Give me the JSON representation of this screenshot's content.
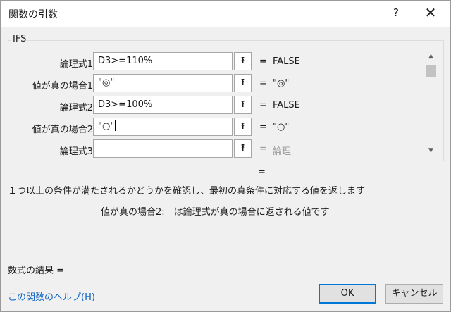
{
  "window": {
    "title": "関数の引数",
    "help_glyph": "?",
    "close_glyph": "✕"
  },
  "group_label": "IFS",
  "args": [
    {
      "label": "論理式1",
      "value": "D3>=110%",
      "eq": "=",
      "result": "FALSE"
    },
    {
      "label": "値が真の場合1",
      "value": "\"◎\"",
      "eq": "=",
      "result": "\"◎\""
    },
    {
      "label": "論理式2",
      "value": "D3>=100%",
      "eq": "=",
      "result": "FALSE"
    },
    {
      "label": "値が真の場合2",
      "value": "\"○\"",
      "eq": "=",
      "result": "\"○\""
    },
    {
      "label": "論理式3",
      "value": "",
      "eq": "=",
      "result": "論理"
    }
  ],
  "ref_glyph": "⭱",
  "scroll": {
    "up": "▲",
    "down": "▼"
  },
  "result_eq": "=",
  "description": "１つ以上の条件が満たされるかどうかを確認し、最初の真条件に対応する値を返します",
  "arg_description": "値が真の場合2:　は論理式が真の場合に返される値です",
  "formula_result": "数式の結果 =",
  "help_link": "この関数のヘルプ(H)",
  "buttons": {
    "ok": "OK",
    "cancel": "キャンセル"
  }
}
